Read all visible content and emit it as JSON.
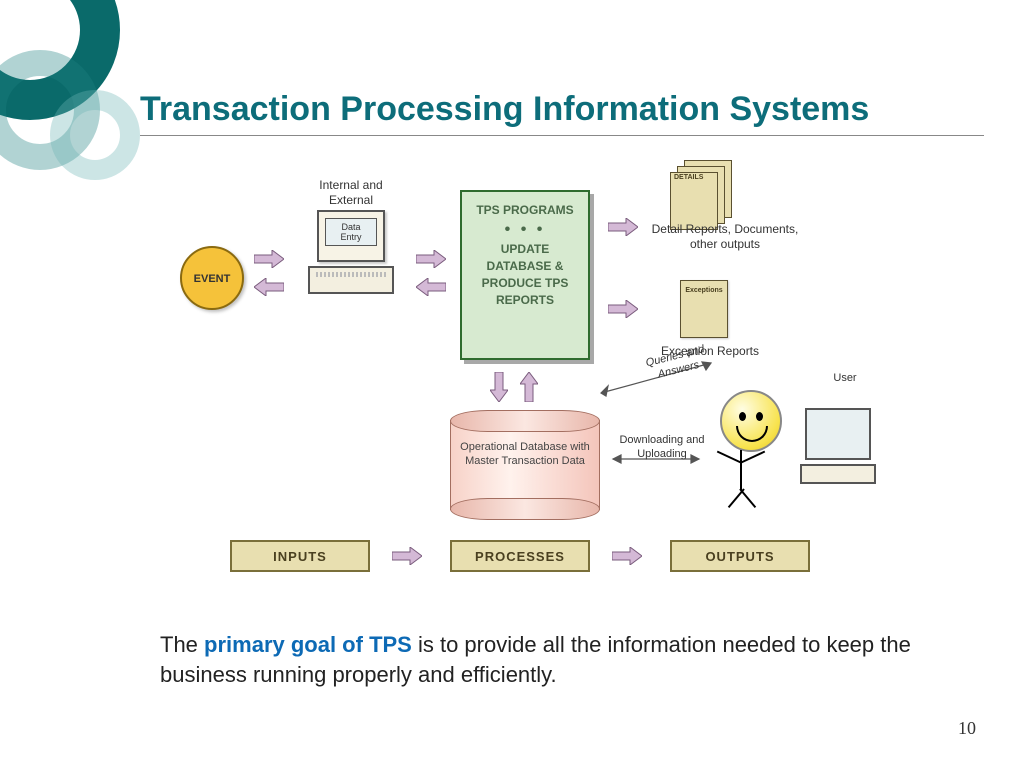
{
  "title": "Transaction Processing Information Systems",
  "diagram": {
    "event": "EVENT",
    "terminal_caption": "Internal and\nExternal",
    "terminal_screen": "Data\nEntry",
    "tps_box_top": "TPS PROGRAMS",
    "tps_box_main": "UPDATE DATABASE & PRODUCE TPS REPORTS",
    "details_tag": "DETAILS",
    "detail_reports_label": "Detail Reports, Documents, other outputs",
    "exceptions_tag": "Exceptions",
    "exception_reports_label": "Exception Reports",
    "queries_label": "Queries and Answers",
    "download_label": "Downloading and Uploading",
    "user_label": "User",
    "db_label": "Operational Database with Master Transaction Data",
    "flow": {
      "inputs": "INPUTS",
      "processes": "PROCESSES",
      "outputs": "OUTPUTS"
    }
  },
  "footnote_prefix": "The ",
  "footnote_highlight": "primary goal of TPS",
  "footnote_rest": " is to provide all the information needed to keep the business running properly and efficiently.",
  "page_number": "10"
}
